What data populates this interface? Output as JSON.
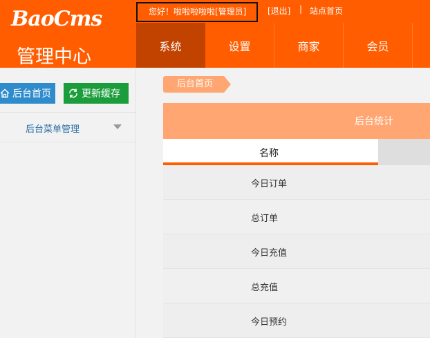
{
  "app": {
    "logo": "BaoCms",
    "subtitle": "管理中心"
  },
  "topbar": {
    "greeting": "您好！啦啦啦啦啦[管理员]",
    "logout": "[退出]",
    "separator": "|",
    "site_home": "站点首页"
  },
  "nav": {
    "items": [
      {
        "label": "系统",
        "active": true
      },
      {
        "label": "设置"
      },
      {
        "label": "商家"
      },
      {
        "label": "会员"
      }
    ]
  },
  "sidebar": {
    "home_button": "后台首页",
    "cache_button": "更新缓存",
    "menu_label": "后台菜单管理"
  },
  "breadcrumb": {
    "home": "后台首页"
  },
  "panel": {
    "title": "后台统计",
    "column_name": "名称",
    "rows": [
      "今日订单",
      "总订单",
      "今日充值",
      "总充值",
      "今日预约"
    ]
  },
  "colors": {
    "brand": "#ff5d00",
    "nav_active": "#c24200",
    "accent_light": "#ffa672",
    "btn_blue": "#2e8bcc",
    "btn_green": "#1b9d3b"
  }
}
